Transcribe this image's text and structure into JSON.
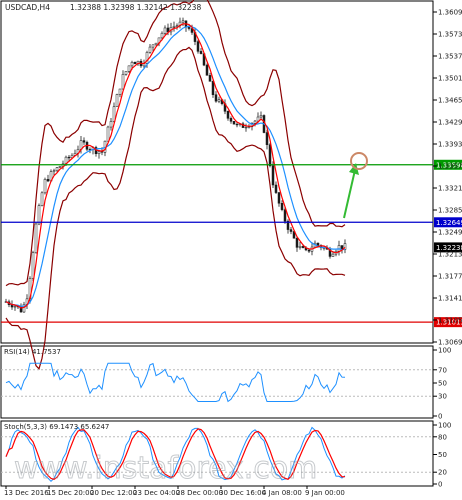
{
  "header": {
    "symbol_tf": "USDCAD,H4",
    "ohlc": "1.32388 1.32398 1.32142 1.32238"
  },
  "indicators": {
    "rsi_label": "RSI(14) 41.7537",
    "stoch_label": "Stoch(5,3,3) 69.1473 65.6247"
  },
  "watermark": "www.instaforex.com",
  "colors": {
    "bullish_candle": "#1a1a1a",
    "bearish_candle": "#1a1a1a",
    "bollinger": "#8b0000",
    "ma_fast": "#ff0000",
    "ma_slow": "#1e90ff",
    "level_green": "#009900",
    "level_blue": "#0000cc",
    "level_red": "#e00000",
    "arrow": "#33bb33",
    "target_circle": "#cc8866",
    "rsi_line": "#1e90ff",
    "stoch_main": "#1e90ff",
    "stoch_signal": "#ff0000"
  },
  "chart_data": {
    "type": "line",
    "y_ticks": [
      "1.36090",
      "1.35730",
      "1.35370",
      "1.35010",
      "1.34650",
      "1.34290",
      "1.33930",
      "1.33570",
      "1.33210",
      "1.32850",
      "1.32490",
      "1.32130",
      "1.31770",
      "1.31410",
      "1.31050",
      "1.30690"
    ],
    "ylim": [
      1.3069,
      1.3609
    ],
    "x_ticks": [
      "13 Dec 2016",
      "15 Dec 20:00",
      "20 Dec 12:00",
      "23 Dec 04:00",
      "28 Dec 00:00",
      "30 Dec 16:00",
      "4 Jan 08:00",
      "9 Jan 00:00"
    ],
    "levels": [
      {
        "name": "resistance",
        "value": 1.3359,
        "label": "1.33590",
        "color": "#009900"
      },
      {
        "name": "pivot",
        "value": 1.32649,
        "label": "1.32649",
        "color": "#0000cc"
      },
      {
        "name": "support",
        "value": 1.31015,
        "label": "1.31015",
        "color": "#e00000"
      }
    ],
    "current_price": {
      "value": 1.32238,
      "label": "1.32238"
    },
    "rsi_ticks": [
      "100",
      "70",
      "50",
      "30",
      "0"
    ],
    "stoch_ticks": [
      "100",
      "80",
      "50",
      "20",
      "0"
    ]
  }
}
